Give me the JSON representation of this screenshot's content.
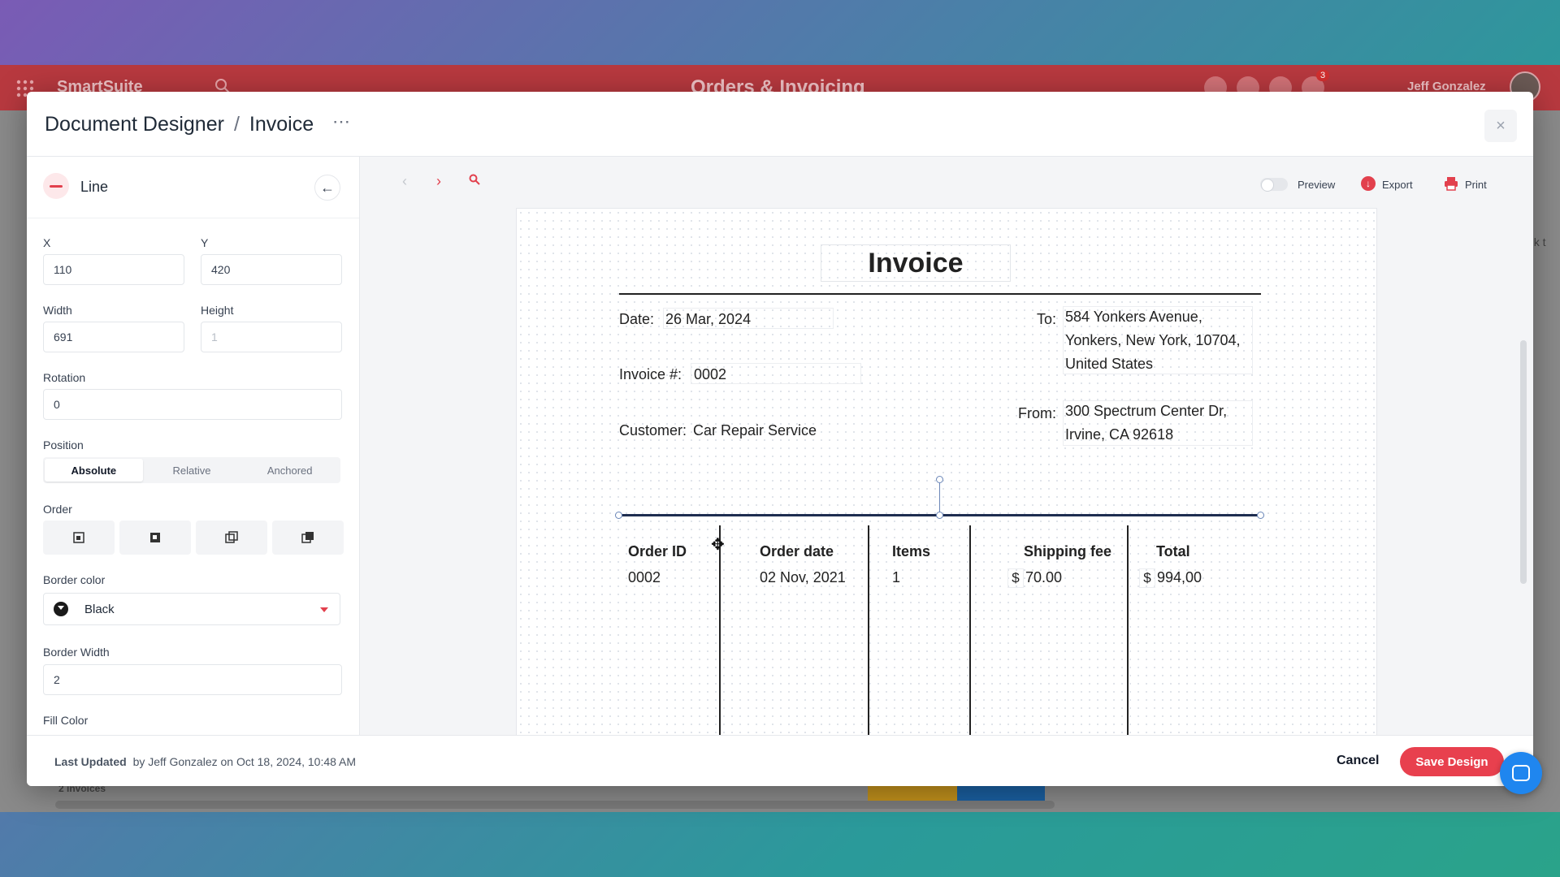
{
  "app": {
    "brand": "SmartSuite",
    "solution_title": "Orders & Invoicing",
    "user_name": "Jeff Gonzalez",
    "notification_count": "3",
    "footer_count": "2 invoices",
    "side_text": "nk t"
  },
  "modal": {
    "breadcrumb_root": "Document Designer",
    "breadcrumb_sep": "/",
    "breadcrumb_current": "Invoice",
    "more_icon": "⋯",
    "close_icon": "×"
  },
  "panel": {
    "title": "Line",
    "fields": {
      "x_label": "X",
      "x_value": "110",
      "y_label": "Y",
      "y_value": "420",
      "width_label": "Width",
      "width_value": "691",
      "height_label": "Height",
      "height_value": "1",
      "rotation_label": "Rotation",
      "rotation_value": "0"
    },
    "position_label": "Position",
    "position_options": [
      "Absolute",
      "Relative",
      "Anchored"
    ],
    "position_selected": "Absolute",
    "order_label": "Order",
    "border_color_label": "Border color",
    "border_color_value": "Black",
    "border_width_label": "Border Width",
    "border_width_value": "2",
    "fill_color_label": "Fill Color"
  },
  "toolbar": {
    "preview_label": "Preview",
    "export_label": "Export",
    "print_label": "Print",
    "preview_enabled": false
  },
  "invoice": {
    "title": "Invoice",
    "date_label": "Date:",
    "date_value": "26 Mar, 2024",
    "invoice_no_label": "Invoice #:",
    "invoice_no_value": "0002",
    "customer_label": "Customer:",
    "customer_value": "Car Repair Service",
    "to_label": "To:",
    "to_address": [
      "584 Yonkers Avenue,",
      "Yonkers, New York, 10704,",
      "United States"
    ],
    "from_label": "From:",
    "from_address": [
      "300 Spectrum Center Dr,",
      "Irvine, CA 92618"
    ],
    "table": {
      "headers": [
        "Order ID",
        "Order date",
        "Items",
        "Shipping fee",
        "Total"
      ],
      "row": {
        "order_id": "0002",
        "order_date": "02 Nov, 2021",
        "items": "1",
        "currency": "$",
        "shipping_fee": "70.00",
        "total": "994,00"
      }
    }
  },
  "footer": {
    "last_updated_label": "Last Updated",
    "last_updated_text": "by Jeff Gonzalez on Oct 18, 2024, 10:48 AM",
    "cancel_label": "Cancel",
    "save_label": "Save Design"
  },
  "colors": {
    "accent": "#e8404e",
    "topbar": "#b8393f",
    "chat": "#1f86ef"
  }
}
